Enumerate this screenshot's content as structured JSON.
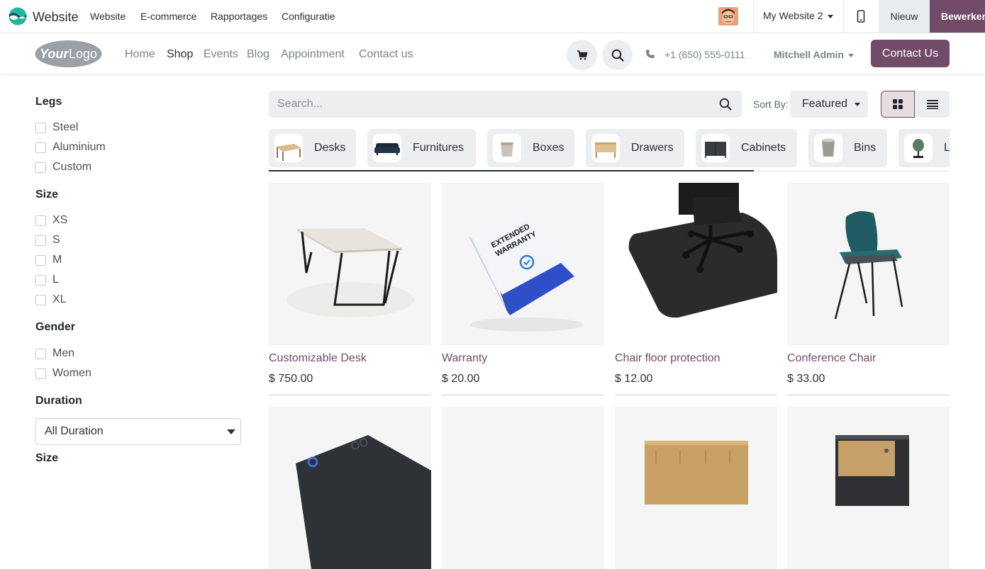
{
  "admin_bar": {
    "app_name": "Website",
    "menu": [
      "Website",
      "E-commerce",
      "Rapportages",
      "Configuratie"
    ],
    "website_switcher": "My Website 2",
    "new_label": "Nieuw",
    "edit_label": "Bewerken"
  },
  "header": {
    "logo_text": "YourLogo",
    "nav": [
      "Home",
      "Shop",
      "Events",
      "Blog",
      "Appointment",
      "Contact us"
    ],
    "active_nav": "Shop",
    "phone": "+1 (650) 555-0111",
    "user": "Mitchell Admin",
    "contact_button": "Contact Us"
  },
  "filters": {
    "legs": {
      "title": "Legs",
      "options": [
        "Steel",
        "Aluminium",
        "Custom"
      ]
    },
    "size": {
      "title": "Size",
      "options": [
        "XS",
        "S",
        "M",
        "L",
        "XL"
      ]
    },
    "gender": {
      "title": "Gender",
      "options": [
        "Men",
        "Women"
      ]
    },
    "duration": {
      "title": "Duration",
      "selected": "All Duration"
    },
    "size2": {
      "title": "Size"
    }
  },
  "search": {
    "placeholder": "Search..."
  },
  "sort": {
    "label": "Sort By:",
    "value": "Featured"
  },
  "categories": [
    "Desks",
    "Furnitures",
    "Boxes",
    "Drawers",
    "Cabinets",
    "Bins",
    "L"
  ],
  "products": [
    {
      "name": "Customizable Desk",
      "price": "$ 750.00"
    },
    {
      "name": "Warranty",
      "price": "$ 20.00"
    },
    {
      "name": "Chair floor protection",
      "price": "$ 12.00"
    },
    {
      "name": "Conference Chair",
      "price": "$ 33.00"
    }
  ],
  "warranty_box_text": [
    "EXTENDED",
    "WARRANTY"
  ],
  "colors": {
    "brand": "#714b67",
    "active_view_bg": "#e6dde3",
    "muted_bg": "#edeef0"
  }
}
